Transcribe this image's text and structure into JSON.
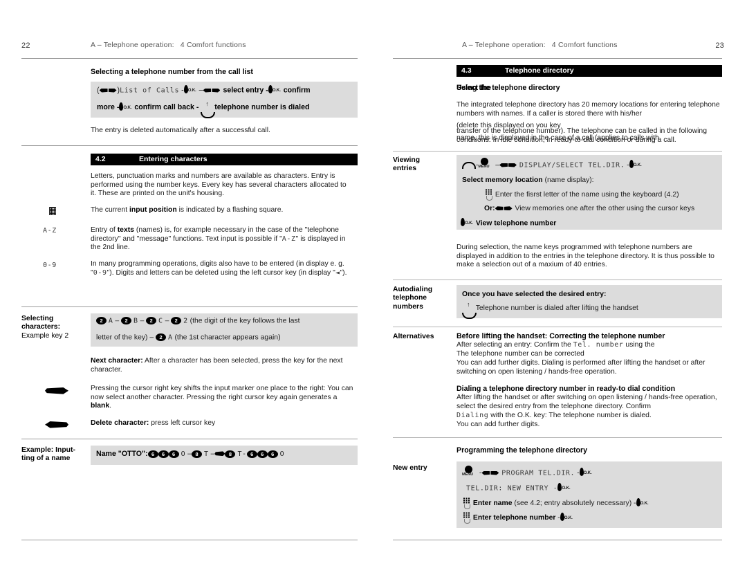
{
  "left_page": {
    "page_number": "22",
    "header": {
      "part": "A – Telephone operation:",
      "chapter": "4",
      "chapter_title": "Comfort functions"
    },
    "call_list": {
      "heading": "Selecting a telephone number from the call list",
      "seq_line1_open": "(",
      "seq_line1_close": ")",
      "seq_display1": "List of Calls",
      "seq_dash1": "-",
      "seq_dash2": "–",
      "seq_text1": "select entry -",
      "seq_text2": "confirm",
      "seq_line2_more": "more -",
      "seq_line2_text": "confirm call back -",
      "seq_line2_end": "telephone number is dialed",
      "after": "The entry is deleted automatically after a successful call."
    },
    "section_42": {
      "number": "4.2",
      "title": "Entering characters",
      "intro": "Letters, punctuation marks and numbers are available as characters. Entry is performed using the number keys. Every key has several characters allocated to it. These are printed on the unit's housing.",
      "row_input_position": {
        "text_a": "The current ",
        "bold": "input position",
        "text_b": " is indicated by a flashing square."
      },
      "row_texts": {
        "marker": "A-Z",
        "text_a": "Entry of ",
        "bold": "texts",
        "text_b": " (names) is, for example necessary in the case of the \"telephone directory\" and \"message\" functions. Text input is possible if",
        "text_c": "\"",
        "lcd": "A-Z",
        "text_d": "\" is displayed in the 2nd line."
      },
      "row_digits": {
        "marker": "0-9",
        "text_a": "In many programming operations, digits also have to be entered (in display e. g. \"",
        "lcd": "0-9",
        "text_b": "\"). Digits and letters can be deleted using the left cursor key (in display \"",
        "lcd2": "◄",
        "text_c": "\")."
      }
    },
    "selecting_characters": {
      "label_line1": "Selecting",
      "label_line2": "characters:",
      "label_line3": "Example key 2",
      "box_line1": {
        "k1": "2",
        "c1": "A",
        "d1": "–",
        "k2": "2",
        "c2": "B",
        "d2": "–",
        "k3": "2",
        "c3": "C",
        "d3": "–",
        "k4": "2",
        "c4": "2",
        "tail": "(the digit of the key follows the last"
      },
      "box_line2": {
        "head": "letter of the key) –",
        "k5": "2",
        "c5": "A",
        "tail": "(the 1st character appears again)"
      },
      "next_character": {
        "bold": "Next character:",
        "text": " After a character has been selected, press the key for the next character."
      },
      "cursor_right": {
        "text_a": "Pressing the cursor right key shifts the input marker one place to the right: You can now select another character. Pressing the right cursor key again generates a ",
        "bold": "blank",
        "text_b": "."
      },
      "delete_character": {
        "bold": "Delete character:",
        "text": " press left cursor key"
      }
    },
    "example_name": {
      "label_line1": "Example: Input-",
      "label_line2": "ting of a name",
      "prefix": "Name \"OTTO\":",
      "k1": "6",
      "k2": "6",
      "k3": "6",
      "c1": "O",
      "d1": "–",
      "k4": "8",
      "c2": "T",
      "d2": "–",
      "k5": "8",
      "c3": "T-",
      "k6": "6",
      "k7": "6",
      "k8": "6",
      "c4": "O"
    }
  },
  "right_page": {
    "page_number": "23",
    "header": {
      "part": "A – Telephone operation:",
      "chapter": "4",
      "chapter_title": "Comfort functions"
    },
    "section_43": {
      "number": "4.3",
      "title": "Telephone directory"
    },
    "using_heading": "Using the telephone directory",
    "using_heading_overlay": "Select the",
    "using_body_1": "The integrated telephone directory has 20 memory locations for entering telephone numbers with names. If a caller is stored there with his/her",
    "using_body_2": "(delete this displayed on you key",
    "using_body_2b": "name, this is displayed in the case of a call (applies to calls with",
    "using_body_3": "transfer of the telephone number). The telephone can be called in the following conditions: In idle condition, in ready-to-dial condition or during a call.",
    "viewing": {
      "label_line1": "Viewing",
      "label_line2": "entries",
      "seq_dash_a": "-",
      "seq_dash_b": "–",
      "seq_display": "DISPLAY/SELECT TEL.DIR.",
      "seq_dash_c": "-",
      "select_memory_bold": "Select memory location",
      "select_memory_rest": " (name display):",
      "enter_first_letter": "Enter the fisrst letter of the name using the keyboard (4.2)",
      "or_label": "Or:",
      "or_text": "View memories one after the other using the cursor keys",
      "view_number": "View telephone number"
    },
    "during_selection": "During selection, the name keys programmed with telephone numbers are displayed in addition to the entries in the telephone directory. It is thus possible to make a selection out of a maxium of 40 entries.",
    "autodialing": {
      "label_line1": "Autodialing",
      "label_line2": "telephone",
      "label_line3": "numbers",
      "heading": "Once you have selected the desired entry:",
      "text": "Telephone number is dialed after lifting the handset"
    },
    "alternatives": {
      "label": "Alternatives",
      "h1": "Before lifting the handset: Correcting the telephone number",
      "p1_a": "After selecting an entry: Confirm the",
      "p1_lcd": "Tel. number",
      "p1_b": "using the",
      "p2": "The telephone number can be corrected",
      "p3": "You can add further digits. Dialing is performed after lifting the handset or after switching on open listening / hands-free operation.",
      "h2": "Dialing a telephone directory number in ready-to dial condition",
      "p4": "After lifting the handset or after switching on open listening / hands-free operation, select the desired entry from the telephone directory. Confirm",
      "p5_lcd": "Dialing",
      "p5_b": "with the O.K. key: The telephone number is dialed.",
      "p6": "You can add further digits."
    },
    "programming": {
      "heading": "Programming the telephone directory",
      "label": "New entry",
      "seq_dash_a": "-",
      "seq_display1": "PROGRAM TEL.DIR.",
      "seq_dash_b": "-",
      "seq_display2": "TEL.DIR: NEW ENTRY -",
      "enter_name_bold": "Enter name",
      "enter_name_rest": " (see 4.2; entry absolutely necessary) -",
      "enter_number_bold": "Enter telephone number",
      "enter_number_rest": " -"
    }
  },
  "colors": {
    "shade": "#dcdcdc",
    "bar": "#000000",
    "rule": "#9a9a9a",
    "text": "#1a1a1a"
  }
}
